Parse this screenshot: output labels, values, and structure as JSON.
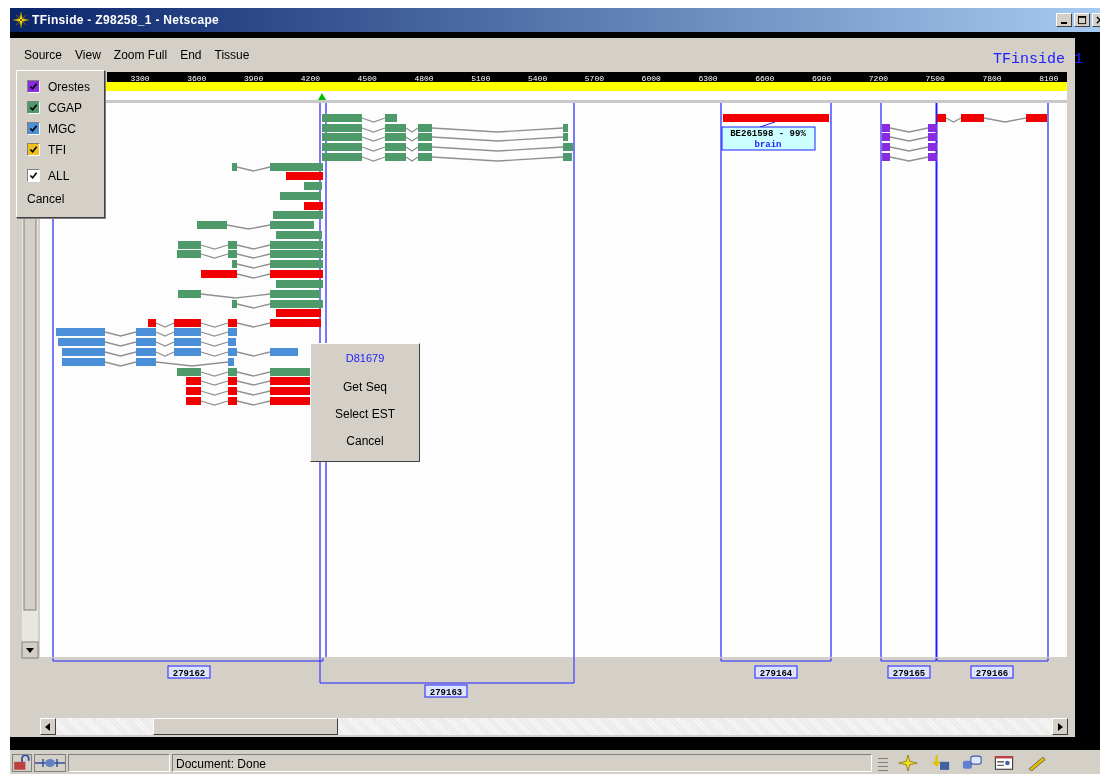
{
  "window": {
    "title": "TFinside - Z98258_1 - Netscape"
  },
  "menu": [
    "Source",
    "View",
    "Zoom Full",
    "End",
    "Tissue"
  ],
  "app_label": "TFinside 1",
  "ruler": {
    "ticks": [
      "3300",
      "3600",
      "3900",
      "4200",
      "4500",
      "4800",
      "5100",
      "5400",
      "5700",
      "6000",
      "6300",
      "6600",
      "6900",
      "7200",
      "7500",
      "7800",
      "8100"
    ]
  },
  "source_menu": {
    "items": [
      {
        "label": "Orestes",
        "checked": true,
        "color": "#8a2be2"
      },
      {
        "label": "CGAP",
        "checked": true,
        "color": "#4e9a6a"
      },
      {
        "label": "MGC",
        "checked": true,
        "color": "#4a8fd8"
      },
      {
        "label": "TFI",
        "checked": true,
        "color": "#f0c020"
      },
      {
        "label": "ALL",
        "checked": true,
        "color": "#ffffff"
      }
    ],
    "cancel": "Cancel"
  },
  "est_tooltip": {
    "accession": "BE261598 - 99%",
    "tissue": "brain"
  },
  "context_menu": {
    "title": "D81679",
    "items": [
      "Get Seq",
      "Select EST",
      "Cancel"
    ]
  },
  "genes": [
    "279162",
    "279163",
    "279164",
    "279165",
    "279166"
  ],
  "status_bar": {
    "text": "Document: Done"
  }
}
